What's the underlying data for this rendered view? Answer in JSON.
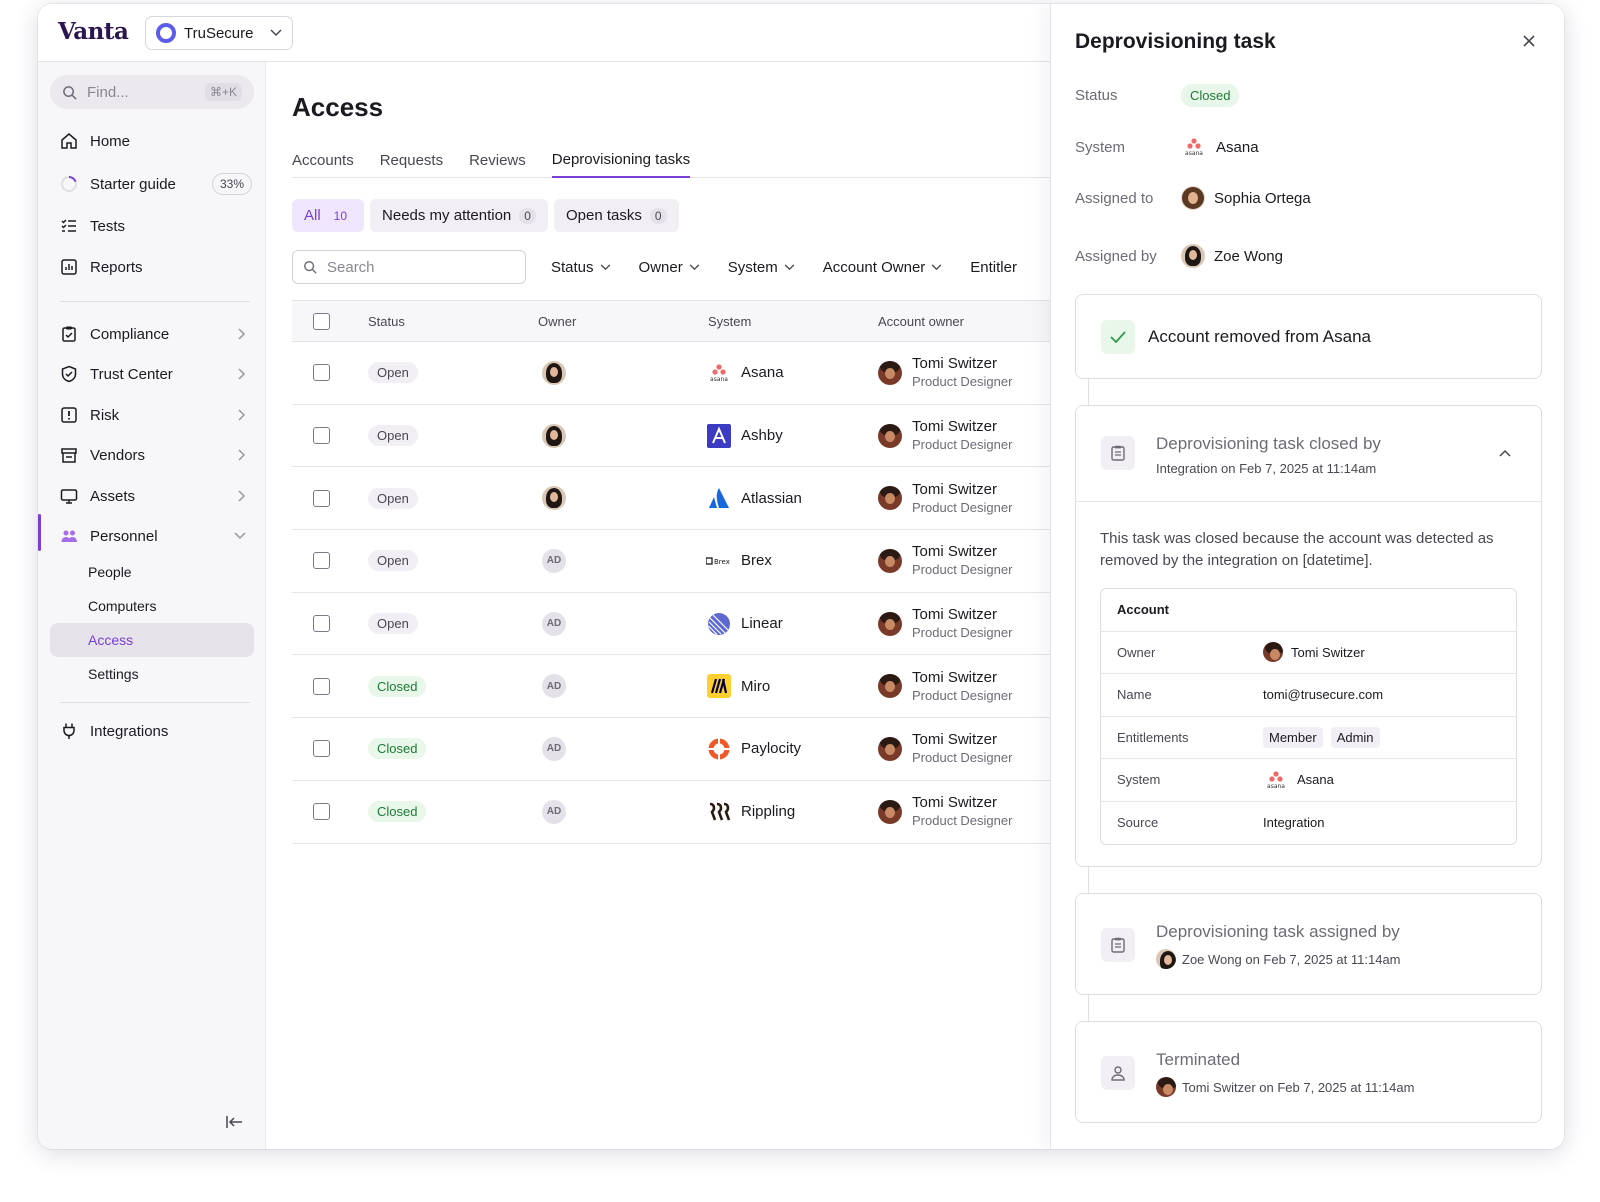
{
  "app": {
    "brand": "Vanta",
    "org": "TruSecure"
  },
  "sidebar": {
    "find_placeholder": "Find...",
    "find_shortcut": "⌘+K",
    "items": [
      {
        "label": "Home",
        "icon": "home-icon"
      },
      {
        "label": "Starter guide",
        "icon": "progress-icon",
        "badge": "33%"
      },
      {
        "label": "Tests",
        "icon": "checklist-icon"
      },
      {
        "label": "Reports",
        "icon": "chart-icon"
      },
      {
        "label": "Compliance",
        "icon": "clipboard-icon"
      },
      {
        "label": "Trust Center",
        "icon": "shield-icon"
      },
      {
        "label": "Risk",
        "icon": "alert-icon"
      },
      {
        "label": "Vendors",
        "icon": "store-icon"
      },
      {
        "label": "Assets",
        "icon": "monitor-icon"
      },
      {
        "label": "Personnel",
        "icon": "people-icon"
      },
      {
        "label": "Integrations",
        "icon": "plug-icon"
      }
    ],
    "personnel_sub": [
      "People",
      "Computers",
      "Access",
      "Settings"
    ],
    "active_sub": "Access"
  },
  "main": {
    "title": "Access",
    "tabs": [
      "Accounts",
      "Requests",
      "Reviews",
      "Deprovisioning tasks"
    ],
    "active_tab": "Deprovisioning tasks",
    "chips": [
      {
        "label": "All",
        "count": "10"
      },
      {
        "label": "Needs my attention",
        "count": "0"
      },
      {
        "label": "Open tasks",
        "count": "0"
      }
    ],
    "search_placeholder": "Search",
    "filters": [
      "Status",
      "Owner",
      "System",
      "Account Owner",
      "Entitler"
    ],
    "columns": [
      "Status",
      "Owner",
      "System",
      "Account owner"
    ],
    "rows": [
      {
        "status": "Open",
        "owner": "zoe",
        "system": "Asana",
        "acct_name": "Tomi Switzer",
        "acct_role": "Product Designer"
      },
      {
        "status": "Open",
        "owner": "zoe",
        "system": "Ashby",
        "acct_name": "Tomi Switzer",
        "acct_role": "Product Designer"
      },
      {
        "status": "Open",
        "owner": "zoe",
        "system": "Atlassian",
        "acct_name": "Tomi Switzer",
        "acct_role": "Product Designer"
      },
      {
        "status": "Open",
        "owner": "AD",
        "system": "Brex",
        "acct_name": "Tomi Switzer",
        "acct_role": "Product Designer"
      },
      {
        "status": "Open",
        "owner": "AD",
        "system": "Linear",
        "acct_name": "Tomi Switzer",
        "acct_role": "Product Designer"
      },
      {
        "status": "Closed",
        "owner": "AD",
        "system": "Miro",
        "acct_name": "Tomi Switzer",
        "acct_role": "Product Designer"
      },
      {
        "status": "Closed",
        "owner": "AD",
        "system": "Paylocity",
        "acct_name": "Tomi Switzer",
        "acct_role": "Product Designer"
      },
      {
        "status": "Closed",
        "owner": "AD",
        "system": "Rippling",
        "acct_name": "Tomi Switzer",
        "acct_role": "Product Designer"
      }
    ]
  },
  "panel": {
    "title": "Deprovisioning task",
    "status_label": "Status",
    "status": "Closed",
    "system_label": "System",
    "system": "Asana",
    "assigned_to_label": "Assigned to",
    "assigned_to": "Sophia Ortega",
    "assigned_by_label": "Assigned by",
    "assigned_by": "Zoe Wong",
    "event_removed": "Account removed from Asana",
    "event_closed": {
      "title": "Deprovisioning task closed by",
      "sub": "Integration on Feb 7, 2025 at 11:14am",
      "body": "This task was closed because the account was detected as removed by the integration on [datetime].",
      "account_header": "Account",
      "fields": {
        "owner_k": "Owner",
        "owner_v": "Tomi Switzer",
        "name_k": "Name",
        "name_v": "tomi@trusecure.com",
        "ent_k": "Entitlements",
        "ent_v1": "Member",
        "ent_v2": "Admin",
        "system_k": "System",
        "system_v": "Asana",
        "source_k": "Source",
        "source_v": "Integration"
      }
    },
    "event_assigned": {
      "title": "Deprovisioning task assigned by",
      "sub": "Zoe Wong on Feb 7, 2025 at 11:14am"
    },
    "event_terminated": {
      "title": "Terminated",
      "sub": "Tomi Switzer on Feb 7, 2025 at 11:14am"
    }
  },
  "colors": {
    "accent": "#7a3fd6",
    "closed_green": "#1e7a36",
    "brand": "#2b1650"
  }
}
